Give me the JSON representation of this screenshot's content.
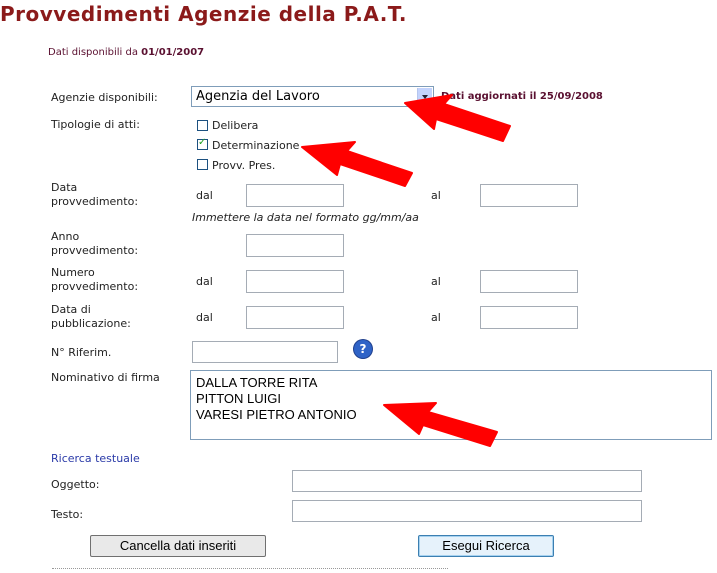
{
  "page": {
    "title": "Provvedimenti Agenzie della P.A.T.",
    "availability_prefix": "Dati disponibili da ",
    "availability_date": "01/01/2007"
  },
  "form": {
    "agency": {
      "label": "Agenzie disponibili:",
      "selected": "Agenzia del Lavoro",
      "updated_note": "Dati aggiornati il 25/09/2008"
    },
    "types": {
      "label": "Tipologie di atti:",
      "options": [
        {
          "label": "Delibera",
          "checked": false
        },
        {
          "label": "Determinazione",
          "checked": true
        },
        {
          "label": "Provv. Pres.",
          "checked": false
        }
      ]
    },
    "date_provision": {
      "label_line1": "Data",
      "label_line2": "provvedimento:",
      "from": "dal",
      "to": "al",
      "hint": "Immettere la data nel formato gg/mm/aa",
      "from_value": "",
      "to_value": ""
    },
    "year_provision": {
      "label_line1": "Anno",
      "label_line2": "provvedimento:",
      "value": ""
    },
    "number_provision": {
      "label_line1": "Numero",
      "label_line2": "provvedimento:",
      "from": "dal",
      "to": "al",
      "from_value": "",
      "to_value": ""
    },
    "publication_date": {
      "label_line1": "Data di",
      "label_line2": "pubblicazione:",
      "from": "dal",
      "to": "al",
      "from_value": "",
      "to_value": ""
    },
    "reference": {
      "label": "N° Riferim.",
      "value": "",
      "help_icon": "question-icon"
    },
    "signatory": {
      "label": "Nominativo di firma",
      "options": [
        "DALLA TORRE RITA",
        "PITTON LUIGI",
        "VARESI PIETRO ANTONIO"
      ]
    },
    "text_search": {
      "link": "Ricerca testuale",
      "subject_label": "Oggetto:",
      "subject_value": "",
      "text_label": "Testo:",
      "text_value": ""
    },
    "buttons": {
      "clear": "Cancella dati inseriti",
      "search": "Esegui Ricerca"
    }
  },
  "annotations": {
    "arrow_color": "#ff0000",
    "arrow_icon": "red-arrow-icon"
  },
  "colors": {
    "title": "#8b1a1a",
    "link": "#2a3aa8",
    "note": "#5a1030"
  }
}
